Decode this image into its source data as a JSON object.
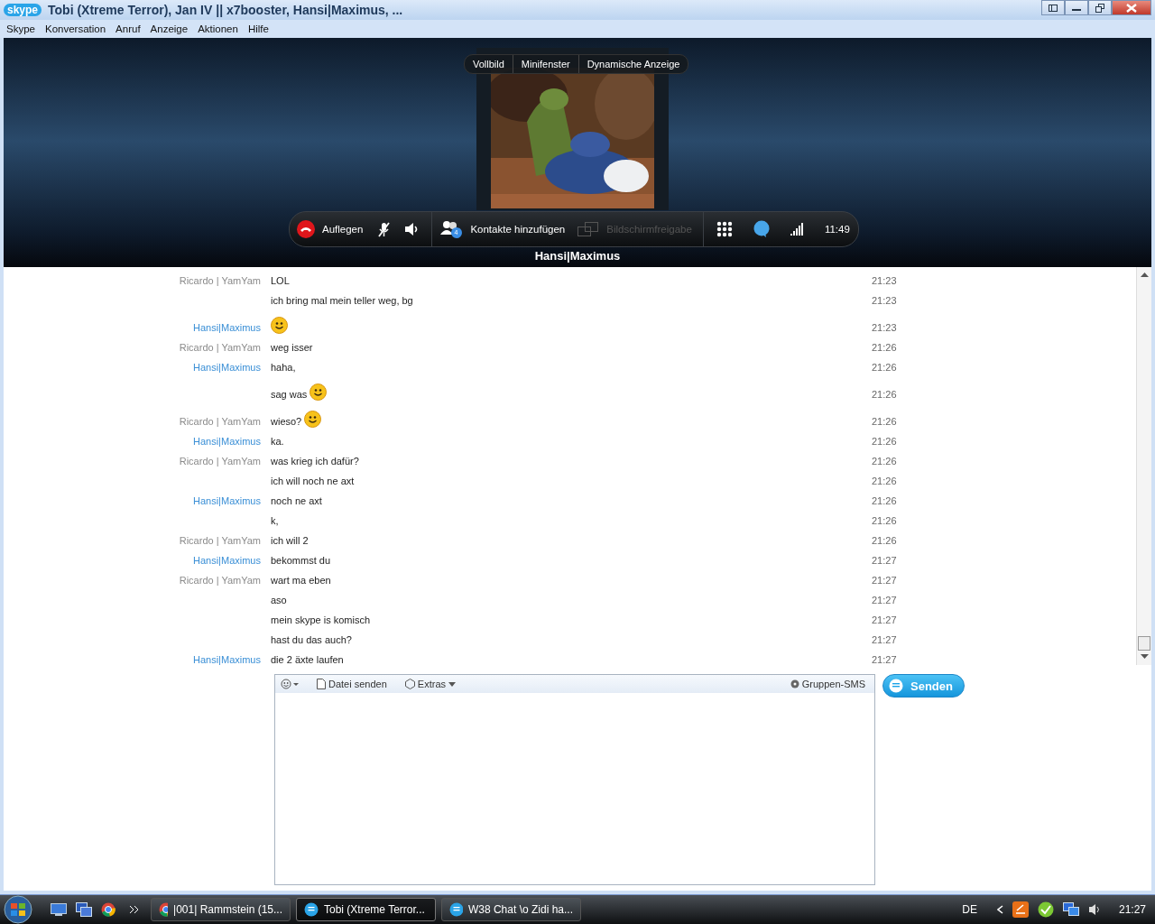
{
  "window": {
    "title": "Tobi (Xtreme Terror), Jan IV || x7booster, Hansi|Maximus, ...",
    "logo": "skype"
  },
  "menu": [
    "Skype",
    "Konversation",
    "Anruf",
    "Anzeige",
    "Aktionen",
    "Hilfe"
  ],
  "video": {
    "view_buttons": [
      "Vollbild",
      "Minifenster",
      "Dynamische Anzeige"
    ],
    "call_bar": {
      "hangup": "Auflegen",
      "muted": true,
      "add_contacts": "Kontakte hinzufügen",
      "add_contacts_count": "4",
      "screen_share": {
        "label": "Bildschirmfreigabe",
        "disabled": true
      },
      "duration": "11:49"
    },
    "caller": "Hansi|Maximus"
  },
  "messages": [
    {
      "sender": "Ricardo | YamYam",
      "color": "#8a8a8a",
      "text": "LOL",
      "smiley": false,
      "time": "21:23"
    },
    {
      "text": "ich bring mal mein teller weg, bg",
      "smiley": false,
      "time": "21:23"
    },
    {
      "sender": "Hansi|Maximus",
      "color": "#3a8fd6",
      "smiley": true,
      "time": "21:23"
    },
    {
      "sender": "Ricardo | YamYam",
      "color": "#8a8a8a",
      "text": "weg isser",
      "smiley": false,
      "time": "21:26"
    },
    {
      "sender": "Hansi|Maximus",
      "color": "#3a8fd6",
      "text": "haha,",
      "smiley": false,
      "time": "21:26"
    },
    {
      "text": "sag was",
      "smiley": true,
      "time": "21:26"
    },
    {
      "sender": "Ricardo | YamYam",
      "color": "#8a8a8a",
      "text": "wieso?",
      "smiley": true,
      "time": "21:26"
    },
    {
      "sender": "Hansi|Maximus",
      "color": "#3a8fd6",
      "text": "ka.",
      "smiley": false,
      "time": "21:26"
    },
    {
      "sender": "Ricardo | YamYam",
      "color": "#8a8a8a",
      "text": "was krieg ich dafür?",
      "smiley": false,
      "time": "21:26"
    },
    {
      "text": "ich will noch ne axt",
      "smiley": false,
      "time": "21:26"
    },
    {
      "sender": "Hansi|Maximus",
      "color": "#3a8fd6",
      "text": "noch ne axt",
      "smiley": false,
      "time": "21:26"
    },
    {
      "text": "k,",
      "smiley": false,
      "time": "21:26"
    },
    {
      "sender": "Ricardo | YamYam",
      "color": "#8a8a8a",
      "text": "ich will 2",
      "smiley": false,
      "time": "21:26"
    },
    {
      "sender": "Hansi|Maximus",
      "color": "#3a8fd6",
      "text": "bekommst du",
      "smiley": false,
      "time": "21:27"
    },
    {
      "sender": "Ricardo | YamYam",
      "color": "#8a8a8a",
      "text": "wart ma eben",
      "smiley": false,
      "time": "21:27"
    },
    {
      "text": "aso",
      "smiley": false,
      "time": "21:27"
    },
    {
      "text": "mein skype is komisch",
      "smiley": false,
      "time": "21:27"
    },
    {
      "text": "hast du das auch?",
      "smiley": false,
      "time": "21:27"
    },
    {
      "sender": "Hansi|Maximus",
      "color": "#3a8fd6",
      "text": "die 2 äxte laufen",
      "smiley": false,
      "time": "21:27"
    }
  ],
  "composer": {
    "send_file": "Datei senden",
    "extras": "Extras",
    "group_sms": "Gruppen-SMS",
    "send": "Senden"
  },
  "taskbar": {
    "tasks": [
      {
        "kind": "browser",
        "label": "|001| Rammstein (15...",
        "selected": false
      },
      {
        "kind": "chat",
        "label": "Tobi (Xtreme Terror...",
        "selected": true
      },
      {
        "kind": "chat",
        "label": "W38 Chat \\o Zidi ha...",
        "selected": false
      }
    ],
    "language": "DE",
    "clock": "21:27"
  }
}
